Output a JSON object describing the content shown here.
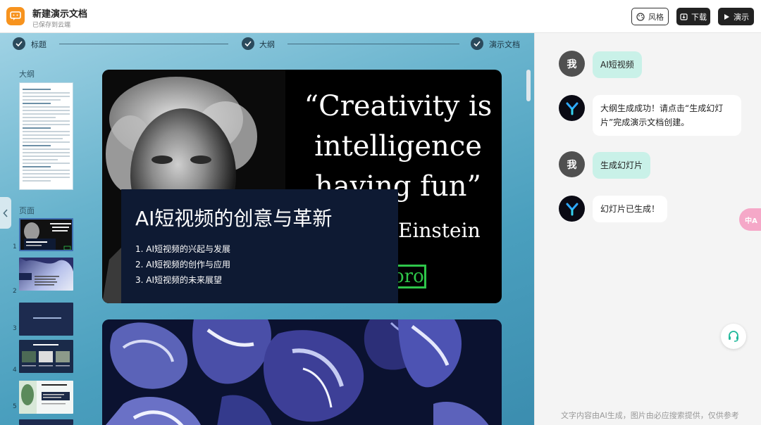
{
  "app": {
    "title": "新建演示文档",
    "status": "已保存到云端",
    "logo_icon": "chat-bubble-icon",
    "brand_color": "#f7931e"
  },
  "toolbar": {
    "style_label": "风格",
    "download_label": "下载",
    "present_label": "演示"
  },
  "steps": [
    {
      "label": "标题",
      "state": "done"
    },
    {
      "label": "大纲",
      "state": "done"
    },
    {
      "label": "演示文档",
      "state": "done"
    }
  ],
  "sidebar": {
    "outline_label": "大纲",
    "pages_label": "页面",
    "pages": [
      {
        "num": "1",
        "selected": true
      },
      {
        "num": "2",
        "selected": false
      },
      {
        "num": "3",
        "selected": false
      },
      {
        "num": "4",
        "selected": false
      },
      {
        "num": "5",
        "selected": false
      }
    ]
  },
  "slide1": {
    "quote_line1": "“Creativity is",
    "quote_line2": "intelligence",
    "quote_line3": "having fun”",
    "quote_author": "Einstein",
    "badge_text": "oro",
    "title": "AI短视频的创意与革新",
    "items": [
      "1. AI短视频的兴起与发展",
      "2. AI短视频的创作与应用",
      "3. AI短视频的未来展望"
    ]
  },
  "chat": {
    "user_avatar": "我",
    "messages": [
      {
        "role": "user",
        "text": "AI短视频"
      },
      {
        "role": "bot",
        "text": "大纲生成成功！请点击“生成幻灯片”完成演示文档创建。"
      },
      {
        "role": "user",
        "text": "生成幻灯片"
      },
      {
        "role": "bot",
        "text": "幻灯片已生成！"
      }
    ],
    "footer": "文字内容由AI生成，图片由必应搜索提供，仅供参考",
    "translate_label": "中A"
  }
}
